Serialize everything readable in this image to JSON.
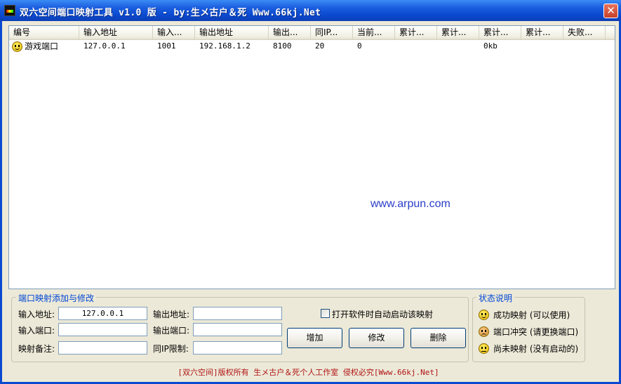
{
  "window": {
    "title": "双六空间端口映射工具 v1.0 版 - by:生メ古户＆死 Www.66kj.Net",
    "close_label": "✕"
  },
  "listview": {
    "columns": [
      "编号",
      "输入地址",
      "输入...",
      "输出地址",
      "输出...",
      "同IP...",
      "当前...",
      "累计...",
      "累计...",
      "累计...",
      "累计...",
      "失败..."
    ],
    "rows": [
      {
        "status": "success",
        "cells": [
          "游戏端口",
          "127.0.0.1",
          "1001",
          "192.168.1.2",
          "8100",
          "20",
          "0",
          "",
          "",
          "0kb",
          "",
          ""
        ]
      }
    ]
  },
  "watermark": "www.arpun.com",
  "edit_group": {
    "legend": "端口映射添加与修改",
    "input_address_label": "输入地址:",
    "input_address_value": "127.0.0.1",
    "input_port_label": "输入端口:",
    "input_port_value": "",
    "remark_label": "映射备注:",
    "remark_value": "",
    "output_address_label": "输出地址:",
    "output_address_value": "",
    "output_port_label": "输出端口:",
    "output_port_value": "",
    "same_ip_label": "同IP限制:",
    "same_ip_value": "",
    "autostart_label": "打开软件时自动启动该映射",
    "autostart_checked": false,
    "add_button": "增加",
    "modify_button": "修改",
    "delete_button": "删除"
  },
  "status_group": {
    "legend": "状态说明",
    "items": [
      {
        "icon": "smiley-success-icon",
        "label": "成功映射 (可以使用)"
      },
      {
        "icon": "smiley-conflict-icon",
        "label": "端口冲突 (请更换端口)"
      },
      {
        "icon": "smiley-inactive-icon",
        "label": "尚未映射 (没有启动的)"
      }
    ]
  },
  "footer": "[双六空间]版权所有 生メ古户＆死个人工作室 侵权必究[Www.66kj.Net]"
}
